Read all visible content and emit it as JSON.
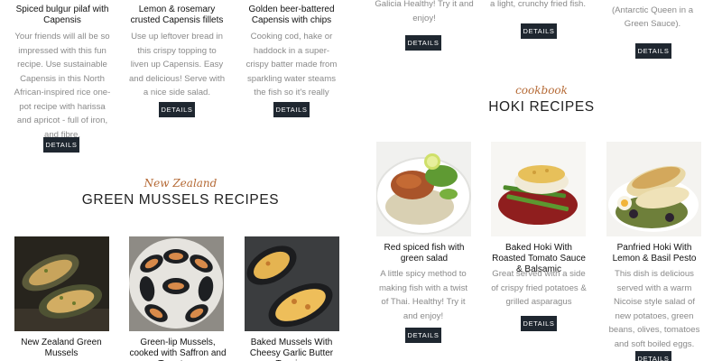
{
  "green_mussels": {
    "kicker": "New Zealand",
    "heading": "GREEN MUSSELS RECIPES",
    "items": [
      {
        "title": "New Zealand Green Mussels"
      },
      {
        "title": "Green-lip Mussels, cooked with Saffron and Tomatoes"
      },
      {
        "title": "Baked Mussels With Cheesy Garlic Butter Topping"
      }
    ]
  },
  "capensis": {
    "items": [
      {
        "title": "Spiced bulgur pilaf with Capensis",
        "description": "Your friends will all be so impressed with this fun recipe. Use sustainable Capensis in this North African-inspired rice one-pot recipe with harissa and apricot - full of iron, and fibre.",
        "button": "DETAILS"
      },
      {
        "title": "Lemon & rosemary crusted Capensis fillets",
        "description": "Use up leftover bread in this crispy topping to liven up Capensis. Easy and delicious! Serve with a nice side salad.",
        "button": "DETAILS"
      },
      {
        "title": "Golden beer-battered Capensis with chips",
        "description": "Cooking cod, hake or haddock in a super-crispy batter made from sparkling water steams the fish so it's really moist",
        "button": "DETAILS"
      }
    ]
  },
  "top_right": {
    "items": [
      {
        "description": "Galicia Healthy! Try it and enjoy!",
        "button": "DETAILS"
      },
      {
        "description": "a light, crunchy fried fish.",
        "button": "DETAILS"
      },
      {
        "description": "Merluza en Salsa Verde (Antarctic Queen in a Green Sauce).",
        "button": "DETAILS"
      }
    ]
  },
  "hoki": {
    "kicker": "cookbook",
    "heading": "HOKI RECIPES",
    "items": [
      {
        "title": "Red spiced fish with green salad",
        "description": "A little spicy method to making fish with a twist of Thai. Healthy! Try it and enjoy!",
        "button": "DETAILS"
      },
      {
        "title": "Baked Hoki With Roasted Tomato Sauce & Balsamic",
        "description": "Great served with a side of crispy fried potatoes & grilled asparagus",
        "button": "DETAILS"
      },
      {
        "title": "Panfried Hoki With Lemon & Basil Pesto",
        "description": "This dish is delicious served with a warm Nicoise style salad of new potatoes, green beans, olives, tomatoes and soft boiled eggs.",
        "button": "DETAILS"
      }
    ]
  }
}
